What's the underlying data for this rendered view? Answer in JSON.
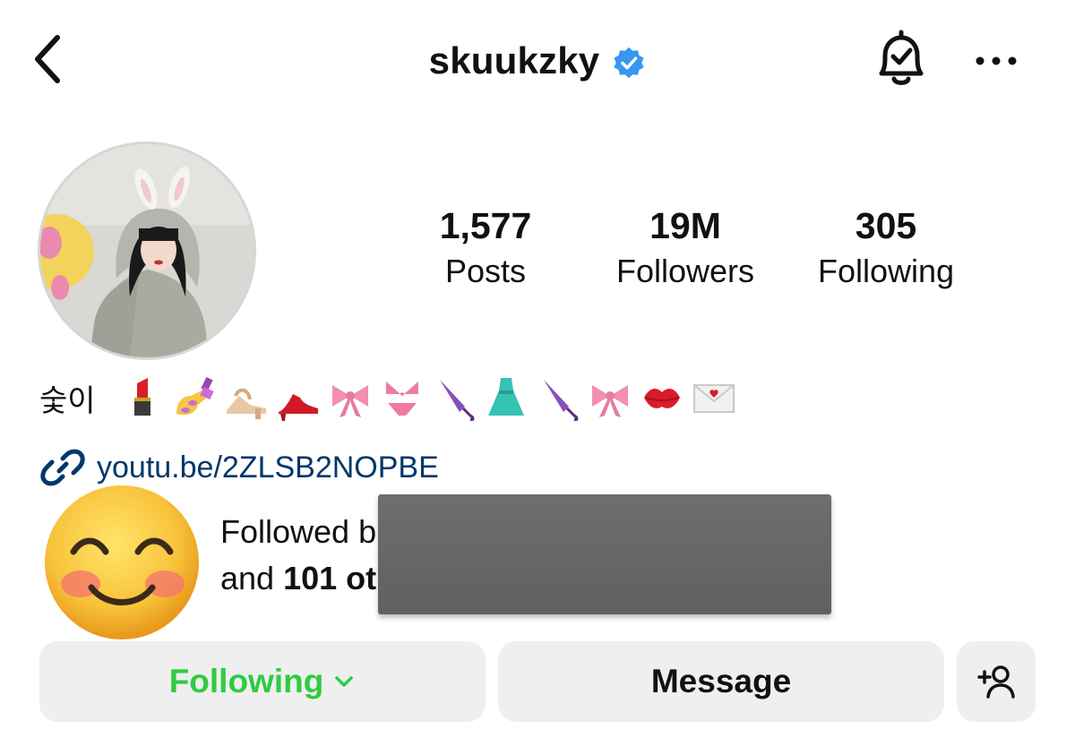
{
  "header": {
    "username": "skuukzky",
    "verified": true,
    "icons": {
      "back": "back-chevron-icon",
      "verified": "verified-badge-icon",
      "bell": "notification-bell-icon",
      "more": "more-horizontal-icon"
    }
  },
  "stats": [
    {
      "value": "1,577",
      "label": "Posts"
    },
    {
      "value": "19M",
      "label": "Followers"
    },
    {
      "value": "305",
      "label": "Following"
    }
  ],
  "bio": {
    "name": "숯이",
    "emojis": [
      "lipstick",
      "nail-polish",
      "womans-sandal",
      "high-heeled-shoe",
      "ribbon",
      "bikini",
      "closed-umbrella",
      "dress",
      "closed-umbrella",
      "ribbon",
      "kiss-mark",
      "envelope"
    ]
  },
  "link": {
    "text": "youtu.be/2ZLSB2NOPBE",
    "icon": "link-icon"
  },
  "followed_by": {
    "line1": "Followed b",
    "line2_prefix": "and ",
    "line2_bold": "101 ot"
  },
  "actions": {
    "following_label": "Following",
    "message_label": "Message",
    "add_user_icon": "add-user-icon"
  },
  "colors": {
    "following_green": "#2ecc40",
    "verified_blue": "#3897f0",
    "link_blue": "#00376b",
    "button_bg": "#efefef"
  }
}
